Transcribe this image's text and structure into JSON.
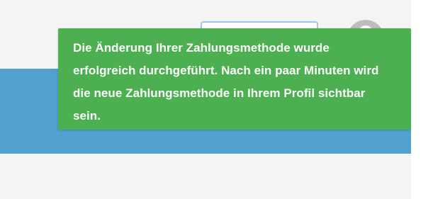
{
  "toast": {
    "message": "Die Änderung Ihrer Zahlungsmethode wurde erfolgreich durchgeführt. Nach ein paar Minuten wird die neue Zahlungsmethode in Ihrem Profil sichtbar sein.",
    "color": "#4caf50",
    "text_color": "#ffffff"
  },
  "header": {
    "avatar_icon": "user-avatar-icon"
  },
  "colors": {
    "page_background": "#f4f4f4",
    "accent_band": "#52a0d0",
    "button_border": "#9fc6e6"
  }
}
